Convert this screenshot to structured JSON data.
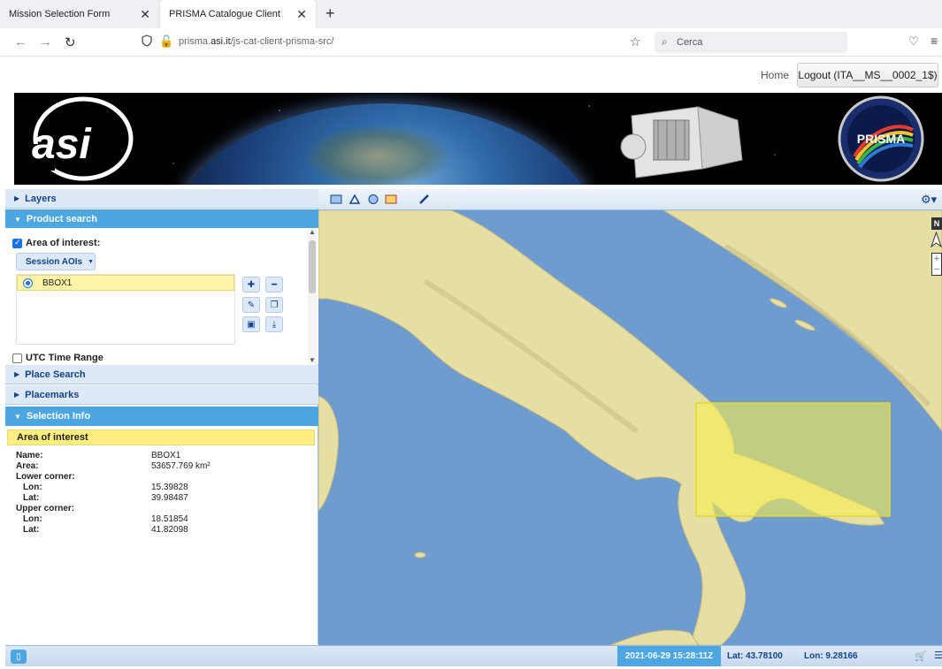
{
  "browser": {
    "tabs": [
      {
        "title": "Mission Selection Form",
        "active": false
      },
      {
        "title": "PRISMA Catalogue Client",
        "active": true
      }
    ],
    "url_prefix": "prisma.",
    "url_domain": "asi.it",
    "url_path": "/js-cat-client-prisma-src/",
    "search_placeholder": "Cerca"
  },
  "header": {
    "home": "Home",
    "logout": "Logout (ITA__MS__0002_1$)",
    "prisma_logo_text": "PRISMA",
    "asi_logo_text": "asi"
  },
  "panel": {
    "layers": "Layers",
    "product_search": "Product search",
    "area_of_interest_label": "Area of interest:",
    "session_aois": "Session AOIs",
    "aois": [
      {
        "name": "BBOX1",
        "selected": true
      }
    ],
    "utc_time_range": "UTC Time Range",
    "place_search": "Place Search",
    "placemarks": "Placemarks",
    "selection_info": "Selection Info"
  },
  "selection_info": {
    "heading": "Area of interest",
    "name_label": "Name:",
    "name": "BBOX1",
    "area_label": "Area:",
    "area": "53657.769 km²",
    "lower_corner_label": "Lower corner:",
    "lower_lon_label": "Lon:",
    "lower_lon": "15.39828",
    "lower_lat_label": "Lat:",
    "lower_lat": "39.98487",
    "upper_corner_label": "Upper corner:",
    "upper_lon_label": "Lon:",
    "upper_lon": "18.51854",
    "upper_lat_label": "Lat:",
    "upper_lat": "41.82098"
  },
  "map": {
    "north_label": "N",
    "aoi_fill": "#f7ef4f",
    "sea_color": "#6e9ccf",
    "land_color": "#e6dfa4"
  },
  "statusbar": {
    "datetime": "2021-06-29 15:28:11Z",
    "lat": "Lat: 43.78100",
    "lon": "Lon: 9.28166"
  },
  "colors": {
    "accent": "#4ba6e1",
    "panel_header": "#dde9f7",
    "header_text": "#15428b"
  }
}
